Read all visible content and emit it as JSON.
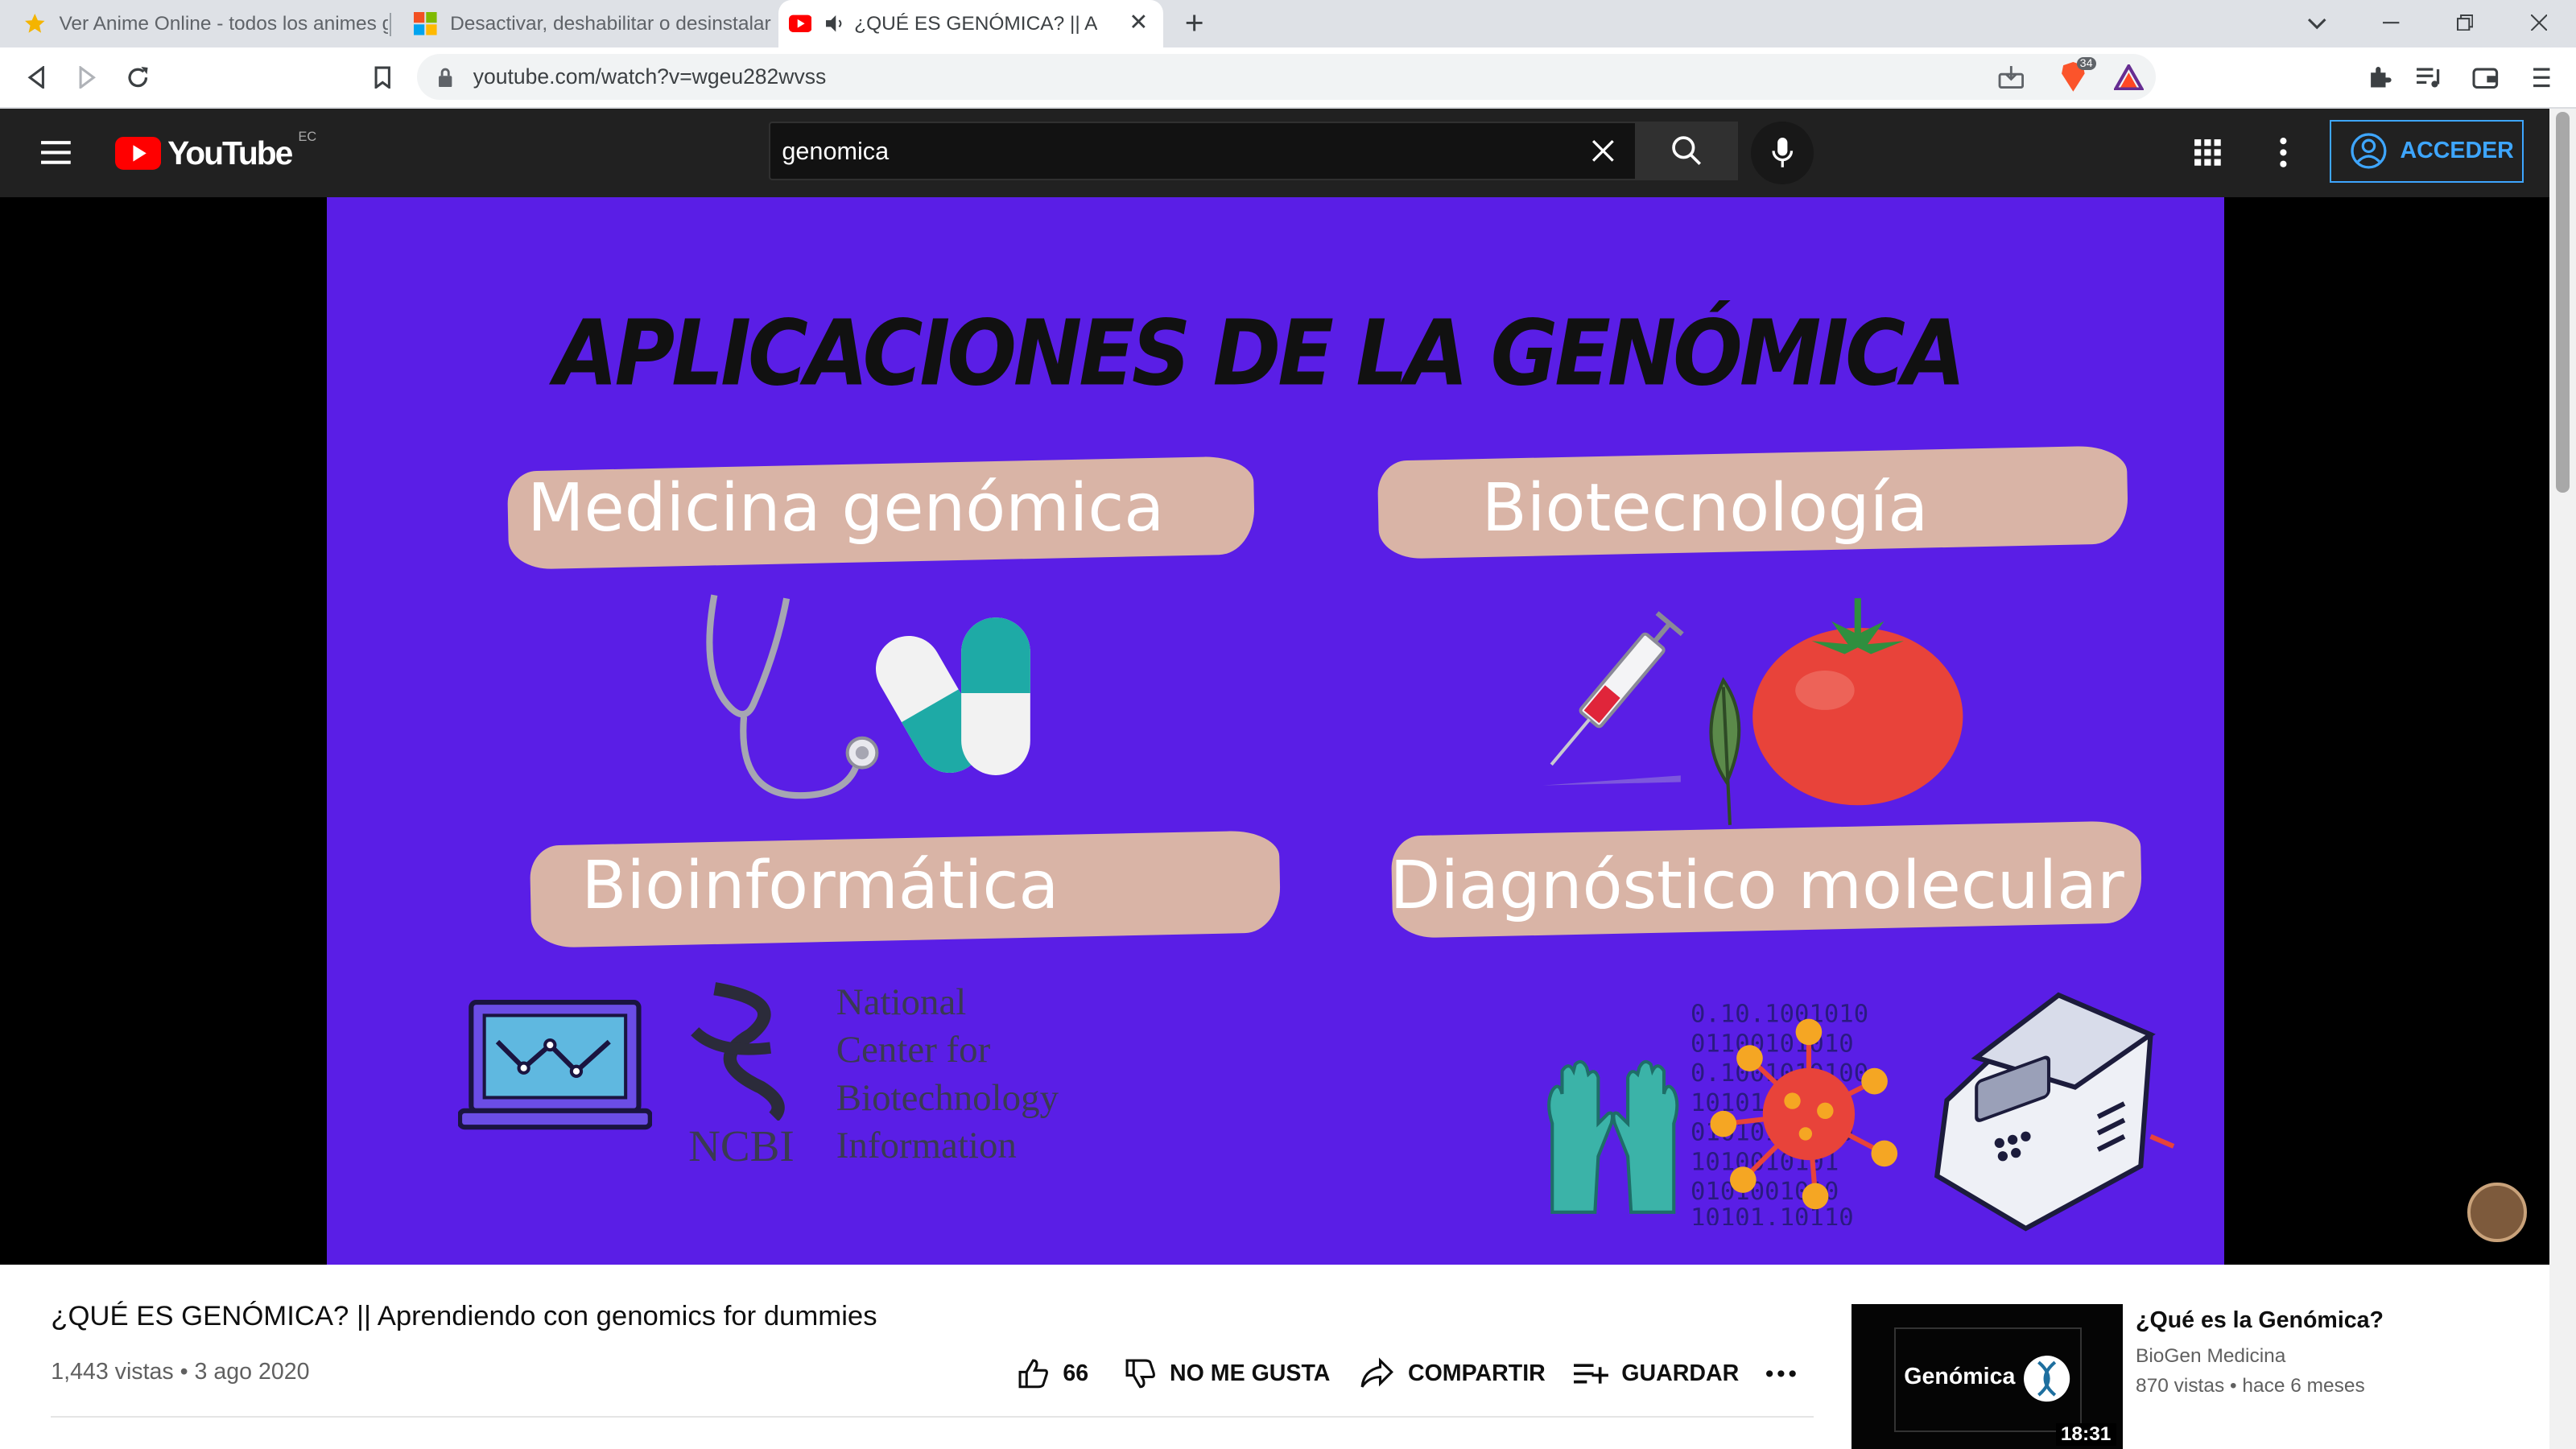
{
  "browser": {
    "tabs": [
      {
        "title": "Ver Anime Online - todos los animes g",
        "icon": "star-icon"
      },
      {
        "title": "Desactivar, deshabilitar o desinstalar C",
        "icon": "microsoft-icon"
      },
      {
        "title": "¿QUÉ ES GENÓMICA? || Aprendiendo",
        "icon": "youtube-icon",
        "active": true
      }
    ],
    "url": "youtube.com/watch?v=wgeu282wvss",
    "brave_badge": "34"
  },
  "youtube": {
    "logo_text": "YouTube",
    "country_code": "EC",
    "search_query": "genomica",
    "signin_label": "ACCEDER"
  },
  "slide": {
    "title": "APLICACIONES DE LA GENÓMICA",
    "labels": [
      "Medicina genómica",
      "Biotecnología",
      "Bioinformática",
      "Diagnóstico molecular"
    ],
    "ncbi_lines": [
      "National",
      "Center for",
      "Biotechnology",
      "Information"
    ],
    "ncbi_word": "NCBI",
    "colors": {
      "background": "#5a1ee6",
      "brush": "#d9b4a6"
    }
  },
  "video": {
    "title": "¿QUÉ ES GENÓMICA? || Aprendiendo con genomics for dummies",
    "views_date": "1,443 vistas • 3 ago 2020",
    "likes": "66",
    "dislike_label": "NO ME GUSTA",
    "share_label": "COMPARTIR",
    "save_label": "GUARDAR"
  },
  "recommended": {
    "title": "¿Qué es la Genómica?",
    "channel": "BioGen Medicina",
    "meta": "870 vistas • hace 6 meses",
    "thumb_text": "Genómica",
    "duration": "18:31"
  }
}
